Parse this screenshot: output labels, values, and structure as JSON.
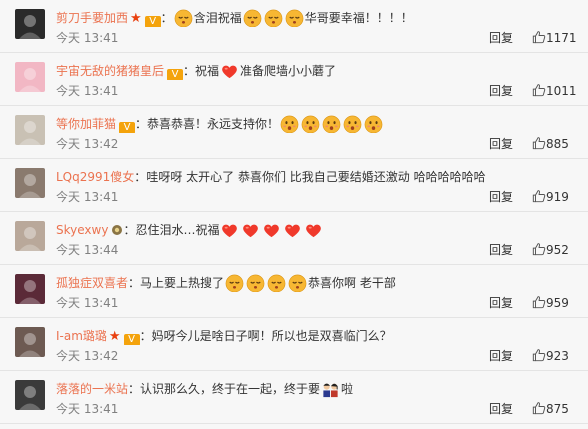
{
  "comments": [
    {
      "user": "剪刀手要加西",
      "badges": [
        "star",
        "v"
      ],
      "text_parts": [
        {
          "type": "emoji",
          "name": "relieved-face"
        },
        {
          "type": "text",
          "value": "含泪祝福"
        },
        {
          "type": "emoji",
          "name": "relieved-face"
        },
        {
          "type": "emoji",
          "name": "relieved-face"
        },
        {
          "type": "emoji",
          "name": "relieved-face"
        },
        {
          "type": "text",
          "value": "华哥要幸福！！！！"
        }
      ],
      "time": "今天 13:41",
      "reply": "回复",
      "likes": "1171",
      "avatar_color": "#2a2a2a"
    },
    {
      "user": "宇宙无敌的猪猪皇后",
      "badges": [
        "v"
      ],
      "text_parts": [
        {
          "type": "text",
          "value": "祝福"
        },
        {
          "type": "emoji",
          "name": "heart"
        },
        {
          "type": "text",
          "value": "准备爬墙小小蘑了"
        }
      ],
      "time": "今天 13:41",
      "reply": "回复",
      "likes": "1011",
      "avatar_color": "#f2b7c4"
    },
    {
      "user": "等你加菲猫",
      "badges": [
        "v"
      ],
      "text_parts": [
        {
          "type": "text",
          "value": "恭喜恭喜！永远支持你！"
        },
        {
          "type": "emoji",
          "name": "kissing-face"
        },
        {
          "type": "emoji",
          "name": "kissing-face"
        },
        {
          "type": "emoji",
          "name": "kissing-face"
        },
        {
          "type": "emoji",
          "name": "kissing-face"
        },
        {
          "type": "emoji",
          "name": "kissing-face"
        }
      ],
      "time": "今天 13:42",
      "reply": "回复",
      "likes": "885",
      "avatar_color": "#c9c1b4"
    },
    {
      "user": "LQq2991傻女",
      "badges": [],
      "text_parts": [
        {
          "type": "text",
          "value": "哇呀呀 太开心了 恭喜你们 比我自己要结婚还激动 哈哈哈哈哈哈"
        }
      ],
      "time": "今天 13:41",
      "reply": "回复",
      "likes": "919",
      "avatar_color": "#8a7a6e"
    },
    {
      "user": "Skyexwy",
      "badges": [
        "medal"
      ],
      "text_parts": [
        {
          "type": "text",
          "value": "忍住泪水…祝福"
        },
        {
          "type": "emoji",
          "name": "heart"
        },
        {
          "type": "emoji",
          "name": "heart"
        },
        {
          "type": "emoji",
          "name": "heart"
        },
        {
          "type": "emoji",
          "name": "heart"
        },
        {
          "type": "emoji",
          "name": "heart"
        }
      ],
      "time": "今天 13:44",
      "reply": "回复",
      "likes": "952",
      "avatar_color": "#b9a89a"
    },
    {
      "user": "孤独症双喜者",
      "badges": [],
      "text_parts": [
        {
          "type": "text",
          "value": "马上要上热搜了"
        },
        {
          "type": "emoji",
          "name": "relieved-face"
        },
        {
          "type": "emoji",
          "name": "relieved-face"
        },
        {
          "type": "emoji",
          "name": "relieved-face"
        },
        {
          "type": "emoji",
          "name": "relieved-face"
        },
        {
          "type": "text",
          "value": "恭喜你啊 老干部"
        }
      ],
      "time": "今天 13:41",
      "reply": "回复",
      "likes": "959",
      "avatar_color": "#5b2a38"
    },
    {
      "user": "I-am璐璐",
      "badges": [
        "star",
        "v"
      ],
      "text_parts": [
        {
          "type": "text",
          "value": "妈呀今儿是啥日子啊！所以也是双喜临门么？"
        }
      ],
      "time": "今天 13:42",
      "reply": "回复",
      "likes": "923",
      "avatar_color": "#6d5a52"
    },
    {
      "user": "落落的一米站",
      "badges": [],
      "text_parts": [
        {
          "type": "text",
          "value": "认识那么久，终于在一起，终于要"
        },
        {
          "type": "emoji",
          "name": "couple"
        },
        {
          "type": "text",
          "value": "啦"
        }
      ],
      "time": "今天 13:41",
      "reply": "回复",
      "likes": "875",
      "avatar_color": "#3a3a3a"
    }
  ],
  "colors": {
    "username": "#eb7350",
    "meta": "#808080",
    "vip_badge": "#f4a30c",
    "star": "#e9400f",
    "heart": "#f0392b",
    "emoji_face": "#f7b733"
  },
  "icons": {
    "like": "thumbs-up-icon"
  }
}
